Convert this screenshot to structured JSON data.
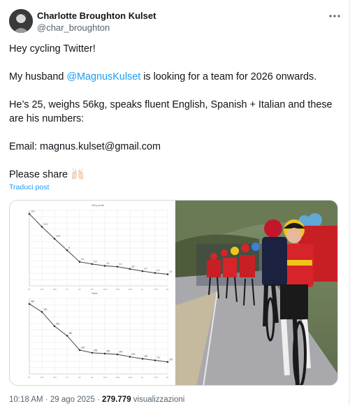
{
  "author": {
    "name": "Charlotte Broughton Kulset",
    "handle": "@char_broughton"
  },
  "tweet": {
    "line1": "Hey cycling Twitter!",
    "line2_prefix": "My husband ",
    "line2_mention": "@MagnusKulset",
    "line2_suffix": " is looking for a team for 2026 onwards.",
    "line3": "He’s 25, weighs 56kg, speaks fluent English, Spanish + Italian and these are his numbers:",
    "line4": "Email: magnus.kulset@gmail.com",
    "line5": "Please share"
  },
  "translate_label": "Traduci post",
  "footer": {
    "time": "10:18 AM",
    "date": "29 ago 2025",
    "views": "279.779",
    "views_label": "visualizzazioni"
  },
  "chart_data": [
    {
      "type": "line",
      "title": "W/kg peaks",
      "x": [
        "5s",
        "15s",
        "30s",
        "1m",
        "2m",
        "5m",
        "10m",
        "20m",
        "30m",
        "1h",
        "1.5h",
        "2h"
      ],
      "y": [
        16.2,
        13.3,
        10.6,
        8.0,
        5.4,
        4.9,
        4.5,
        4.3,
        3.8,
        3.3,
        2.9,
        2.6
      ],
      "ylim": [
        0,
        17
      ],
      "grid": true
    },
    {
      "type": "line",
      "title": "Watts",
      "x": [
        "5s",
        "15s",
        "30s",
        "1m",
        "2m",
        "5m",
        "10m",
        "20m",
        "30m",
        "1h",
        "1.5h",
        "2h"
      ],
      "y": [
        880,
        780,
        600,
        480,
        300,
        265,
        255,
        245,
        215,
        190,
        170,
        150
      ],
      "ylim": [
        0,
        950
      ],
      "grid": true
    }
  ],
  "colors": {
    "link": "#1d9bf0",
    "muted": "#536471",
    "text": "#0f1419",
    "border": "#cfd9de"
  },
  "icons": {
    "more": "more-dots-icon",
    "emoji": "raising-hands-emoji"
  }
}
